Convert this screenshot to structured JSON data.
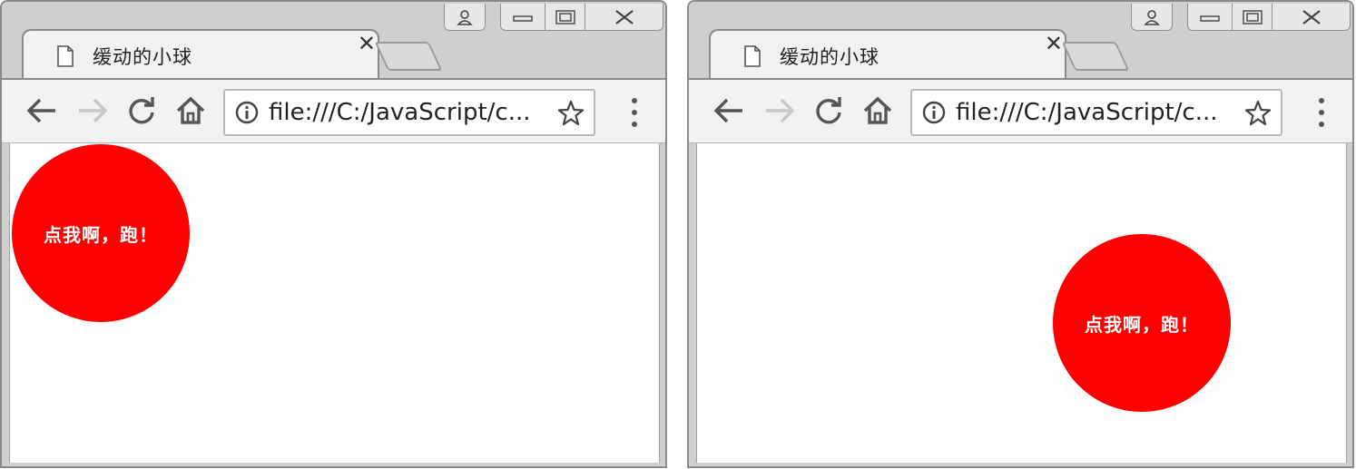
{
  "windows": [
    {
      "tab_title": "缓动的小球",
      "url": "file:///C:/JavaScript/c...",
      "ball_label": "点我啊，跑！"
    },
    {
      "tab_title": "缓动的小球",
      "url": "file:///C:/JavaScript/c...",
      "ball_label": "点我啊，跑！"
    }
  ],
  "icons": {
    "profile": "person-icon",
    "minimize": "minimize-icon",
    "maximize": "maximize-icon",
    "close": "close-icon",
    "page": "page-icon",
    "tab_close": "tab-close-icon",
    "back": "back-arrow-icon",
    "forward": "forward-arrow-icon",
    "reload": "reload-icon",
    "home": "home-icon",
    "info": "info-icon",
    "bookmark": "star-icon",
    "menu": "kebab-menu-icon"
  },
  "colors": {
    "ball": "#ff0000",
    "ball_text": "#ffffff",
    "chrome": "#cfcfcf",
    "toolbar": "#f2f2f2"
  }
}
